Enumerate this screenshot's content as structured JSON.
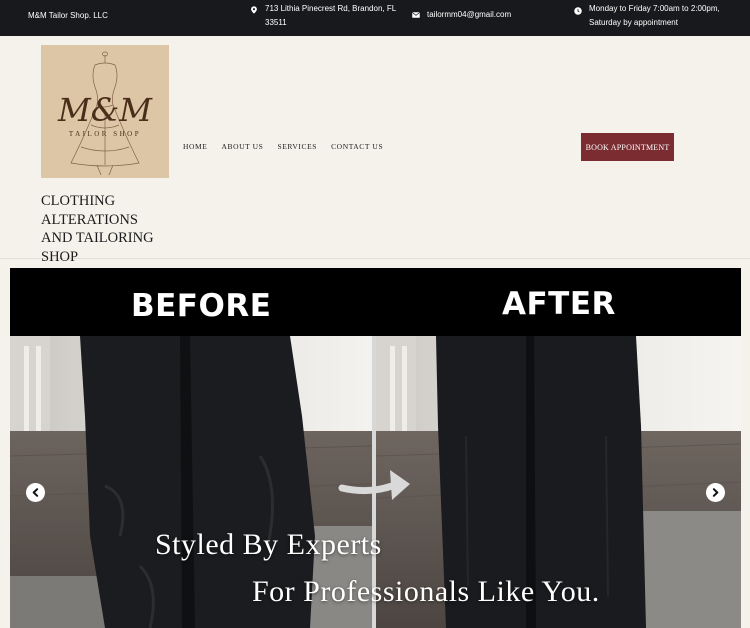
{
  "topbar": {
    "company": "M&M Tailor Shop. LLC",
    "address": "713 Lithia Pinecrest Rd, Brandon, FL 33511",
    "email": "tailormm04@gmail.com",
    "hours": "Monday to Friday 7:00am to 2:00pm, Saturday by appointment",
    "icons": [
      "location-pin-icon",
      "envelope-icon",
      "clock-icon"
    ]
  },
  "logo": {
    "monogram": "M&M",
    "subtitle": "TAILOR SHOP",
    "background": "#dcc6a5",
    "ink": "#4a2e1a"
  },
  "header": {
    "tagline": "CLOTHING ALTERATIONS AND TAILORING SHOP"
  },
  "nav": {
    "items": [
      {
        "label": "HOME"
      },
      {
        "label": "ABOUT US"
      },
      {
        "label": "SERVICES"
      },
      {
        "label": "CONTACT US"
      }
    ]
  },
  "book_button": {
    "label": "BOOK APPOINTMENT",
    "color": "#7a2c31"
  },
  "hero": {
    "before_label": "BEFORE",
    "after_label": "AFTER",
    "line1": "Styled By Experts",
    "line2": "For Professionals Like You.",
    "prev_icon": "chevron-left-icon",
    "next_icon": "chevron-right-icon"
  },
  "colors": {
    "topbar": "#17191c",
    "page_background": "#f4f2ea",
    "accent": "#7a2c31"
  }
}
